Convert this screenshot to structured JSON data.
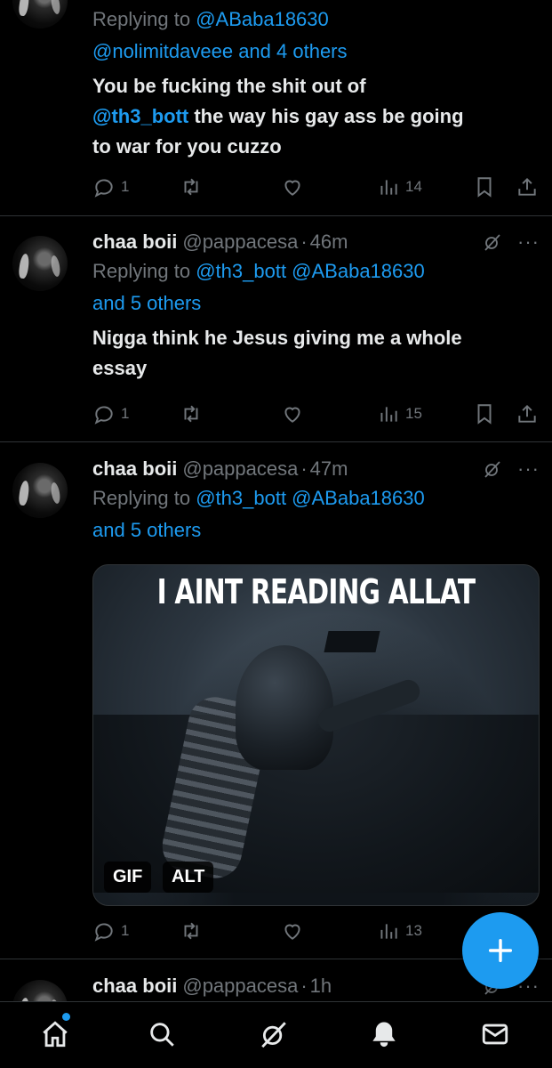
{
  "tweets": [
    {
      "reply_prefix": "Replying to",
      "reply_mentions": "@ABaba18630",
      "reply_line2": "@nolimitdaveee and 4 others",
      "text_line1": "You be fucking the shit out of",
      "text_mention": "@th3_bott",
      "text_line2_rest": " the way his gay ass be going",
      "text_line3": "to war for you cuzzo",
      "replies": "1",
      "views": "14"
    },
    {
      "name": "chaa boii",
      "handle": "@pappacesa",
      "separator": "·",
      "time": "46m",
      "reply_prefix": "Replying to",
      "reply_mentions": "@th3_bott @ABaba18630",
      "reply_line2": "and 5 others",
      "text_line1": "Nigga think he Jesus giving me a whole",
      "text_line2": "essay",
      "replies": "1",
      "views": "15"
    },
    {
      "name": "chaa boii",
      "handle": "@pappacesa",
      "separator": "·",
      "time": "47m",
      "reply_prefix": "Replying to",
      "reply_mentions": "@th3_bott @ABaba18630",
      "reply_line2": "and 5 others",
      "media_caption": "I AINT READING ALLAT",
      "media_badge_gif": "GIF",
      "media_badge_alt": "ALT",
      "replies": "1",
      "views": "13"
    },
    {
      "name": "chaa boii",
      "handle": "@pappacesa",
      "separator": "·",
      "time": "1h"
    }
  ],
  "icons": {
    "reply": "reply-icon",
    "retweet": "retweet-icon",
    "like": "like-icon",
    "views": "views-icon",
    "bookmark": "bookmark-icon",
    "share": "share-icon",
    "grok": "grok-icon",
    "more": "more-icon",
    "compose": "compose-icon"
  },
  "tabs": [
    "home",
    "search",
    "grok",
    "notifications",
    "messages"
  ],
  "colors": {
    "background": "#000000",
    "accent": "#1d9bf0",
    "text_primary": "#e7e9ea",
    "text_secondary": "#71767b",
    "divider": "#2f3336"
  }
}
